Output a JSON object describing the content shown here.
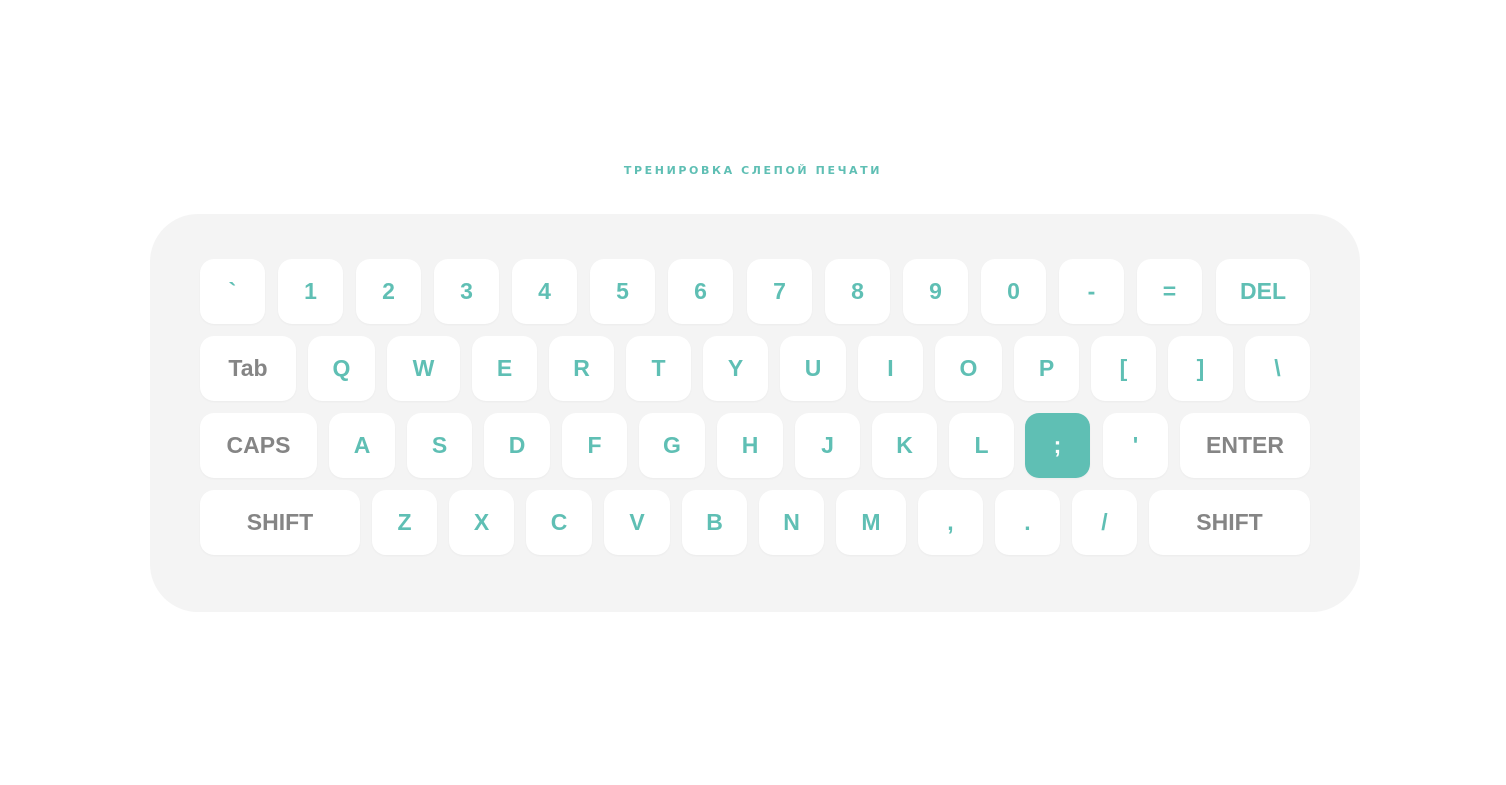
{
  "title": "ТРЕНИРОВКА СЛЕПОЙ ПЕЧАТИ",
  "accent_color": "#5fbfb4",
  "function_key_color": "#858585",
  "active_key": ";",
  "rows": [
    {
      "keys": [
        {
          "label": "`"
        },
        {
          "label": "1"
        },
        {
          "label": "2"
        },
        {
          "label": "3"
        },
        {
          "label": "4"
        },
        {
          "label": "5"
        },
        {
          "label": "6"
        },
        {
          "label": "7"
        },
        {
          "label": "8"
        },
        {
          "label": "9"
        },
        {
          "label": "0"
        },
        {
          "label": "-"
        },
        {
          "label": "="
        },
        {
          "label": "DEL"
        }
      ]
    },
    {
      "keys": [
        {
          "label": "Tab"
        },
        {
          "label": "Q"
        },
        {
          "label": "W"
        },
        {
          "label": "E"
        },
        {
          "label": "R"
        },
        {
          "label": "T"
        },
        {
          "label": "Y"
        },
        {
          "label": "U"
        },
        {
          "label": "I"
        },
        {
          "label": "O"
        },
        {
          "label": "P"
        },
        {
          "label": "["
        },
        {
          "label": "]"
        },
        {
          "label": "\\"
        }
      ]
    },
    {
      "keys": [
        {
          "label": "CAPS"
        },
        {
          "label": "A"
        },
        {
          "label": "S"
        },
        {
          "label": "D"
        },
        {
          "label": "F"
        },
        {
          "label": "G"
        },
        {
          "label": "H"
        },
        {
          "label": "J"
        },
        {
          "label": "K"
        },
        {
          "label": "L"
        },
        {
          "label": ";"
        },
        {
          "label": "'"
        },
        {
          "label": "ENTER"
        }
      ]
    },
    {
      "keys": [
        {
          "label": "SHIFT"
        },
        {
          "label": "Z"
        },
        {
          "label": "X"
        },
        {
          "label": "C"
        },
        {
          "label": "V"
        },
        {
          "label": "B"
        },
        {
          "label": "N"
        },
        {
          "label": "M"
        },
        {
          "label": ","
        },
        {
          "label": "."
        },
        {
          "label": "/"
        },
        {
          "label": "SHIFT"
        }
      ]
    }
  ]
}
